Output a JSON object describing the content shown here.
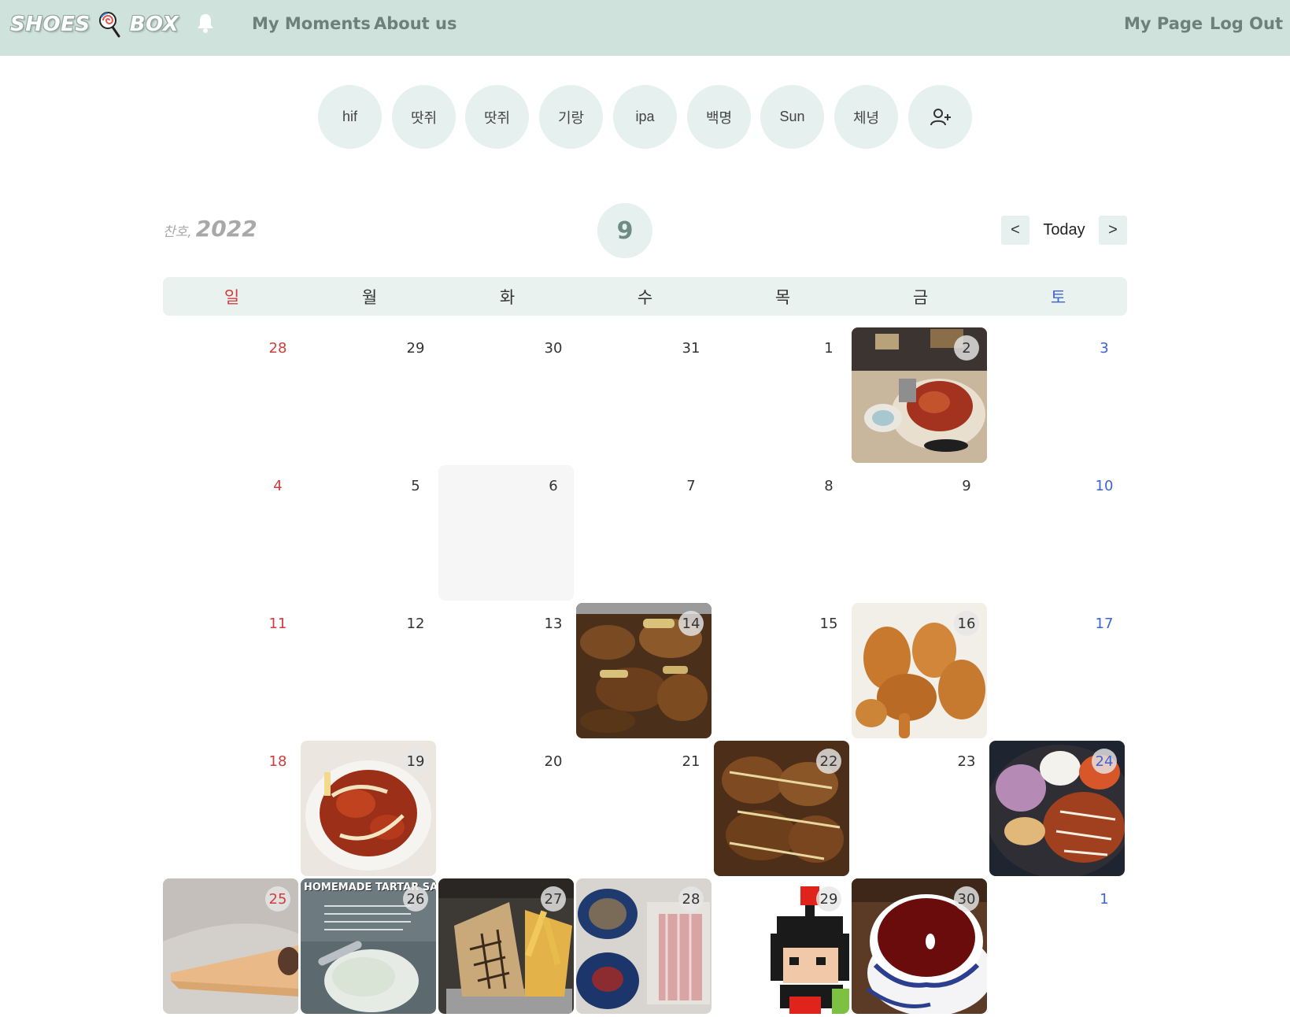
{
  "nav": {
    "logo_left": "SHOES",
    "logo_right": "BOX",
    "my_moments": "My Moments",
    "about_us": "About us",
    "my_page": "My Page",
    "log_out": "Log Out"
  },
  "friends": [
    "hif",
    "땃쥐",
    "땃쥐",
    "기랑",
    "ipa",
    "백명",
    "Sun",
    "체녕"
  ],
  "header": {
    "user_prefix": "찬호,",
    "year": "2022",
    "month": "9",
    "prev": "<",
    "today": "Today",
    "next": ">"
  },
  "weekdays": [
    "일",
    "월",
    "화",
    "수",
    "목",
    "금",
    "토"
  ],
  "days": [
    {
      "n": "28",
      "photo": ""
    },
    {
      "n": "29",
      "photo": ""
    },
    {
      "n": "30",
      "photo": ""
    },
    {
      "n": "31",
      "photo": ""
    },
    {
      "n": "1",
      "photo": ""
    },
    {
      "n": "2",
      "photo": "food-plate"
    },
    {
      "n": "3",
      "photo": ""
    },
    {
      "n": "4",
      "photo": ""
    },
    {
      "n": "5",
      "photo": ""
    },
    {
      "n": "6",
      "photo": "",
      "today": true
    },
    {
      "n": "7",
      "photo": ""
    },
    {
      "n": "8",
      "photo": ""
    },
    {
      "n": "9",
      "photo": ""
    },
    {
      "n": "10",
      "photo": ""
    },
    {
      "n": "11",
      "photo": ""
    },
    {
      "n": "12",
      "photo": ""
    },
    {
      "n": "13",
      "photo": ""
    },
    {
      "n": "14",
      "photo": "braised-chicken"
    },
    {
      "n": "15",
      "photo": ""
    },
    {
      "n": "16",
      "photo": "fried-chicken"
    },
    {
      "n": "17",
      "photo": ""
    },
    {
      "n": "18",
      "photo": ""
    },
    {
      "n": "19",
      "photo": "spicy-stirfry"
    },
    {
      "n": "20",
      "photo": ""
    },
    {
      "n": "21",
      "photo": ""
    },
    {
      "n": "22",
      "photo": "glazed-chicken"
    },
    {
      "n": "23",
      "photo": ""
    },
    {
      "n": "24",
      "photo": "cutlet-plate"
    },
    {
      "n": "25",
      "photo": "crepe"
    },
    {
      "n": "26",
      "photo": "tartar-sauce"
    },
    {
      "n": "27",
      "photo": "fries"
    },
    {
      "n": "28",
      "photo": "bacon-sides"
    },
    {
      "n": "29",
      "photo": "pixel-character"
    },
    {
      "n": "30",
      "photo": "tea-cup"
    },
    {
      "n": "1",
      "photo": ""
    }
  ],
  "photo_text": {
    "tartar_title": "HOMEMADE TARTAR SAUCE"
  },
  "colors": {
    "navbar": "#cfe3dc",
    "accent_circle": "#e6f0ee",
    "sunday": "#d23c3c",
    "saturday": "#3d63d6"
  }
}
